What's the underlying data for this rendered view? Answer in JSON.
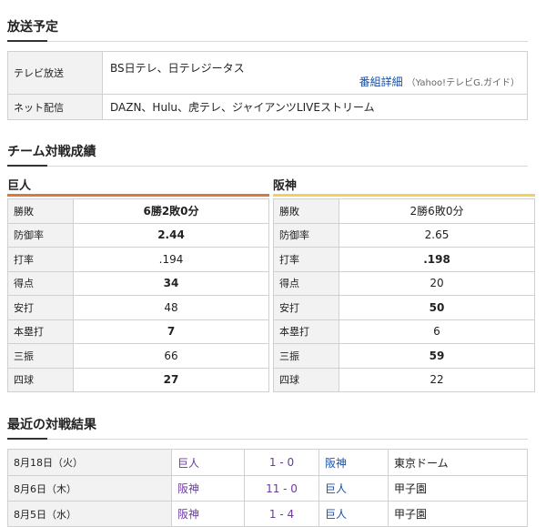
{
  "broadcast": {
    "title": "放送予定",
    "tv_label": "テレビ放送",
    "tv_value": "BS日テレ、日テレジータス",
    "detail_link": "番組詳細",
    "detail_source": "（Yahoo!テレビG.ガイド）",
    "net_label": "ネット配信",
    "net_value": "DAZN、Hulu、虎テレ、ジャイアンツLIVEストリーム"
  },
  "matchup": {
    "title": "チーム対戦成績",
    "teams": [
      {
        "name": "巨人",
        "color": "#d97a3a",
        "stats": [
          {
            "label": "勝敗",
            "value": "6勝2敗0分",
            "bold": true
          },
          {
            "label": "防御率",
            "value": "2.44",
            "bold": true
          },
          {
            "label": "打率",
            "value": ".194",
            "bold": false
          },
          {
            "label": "得点",
            "value": "34",
            "bold": true
          },
          {
            "label": "安打",
            "value": "48",
            "bold": false
          },
          {
            "label": "本塁打",
            "value": "7",
            "bold": true
          },
          {
            "label": "三振",
            "value": "66",
            "bold": false
          },
          {
            "label": "四球",
            "value": "27",
            "bold": true
          }
        ]
      },
      {
        "name": "阪神",
        "color": "#f2d15a",
        "stats": [
          {
            "label": "勝敗",
            "value": "2勝6敗0分",
            "bold": false
          },
          {
            "label": "防御率",
            "value": "2.65",
            "bold": false
          },
          {
            "label": "打率",
            "value": ".198",
            "bold": true
          },
          {
            "label": "得点",
            "value": "20",
            "bold": false
          },
          {
            "label": "安打",
            "value": "50",
            "bold": true
          },
          {
            "label": "本塁打",
            "value": "6",
            "bold": false
          },
          {
            "label": "三振",
            "value": "59",
            "bold": true
          },
          {
            "label": "四球",
            "value": "22",
            "bold": false
          }
        ]
      }
    ]
  },
  "recent": {
    "title": "最近の対戦結果",
    "results": [
      {
        "date": "8月18日（火）",
        "home": "巨人",
        "score": "1 - 0",
        "away": "阪神",
        "venue": "東京ドーム"
      },
      {
        "date": "8月6日（木）",
        "home": "阪神",
        "score": "11 - 0",
        "away": "巨人",
        "venue": "甲子園"
      },
      {
        "date": "8月5日（水）",
        "home": "阪神",
        "score": "1 - 4",
        "away": "巨人",
        "venue": "甲子園"
      }
    ]
  }
}
